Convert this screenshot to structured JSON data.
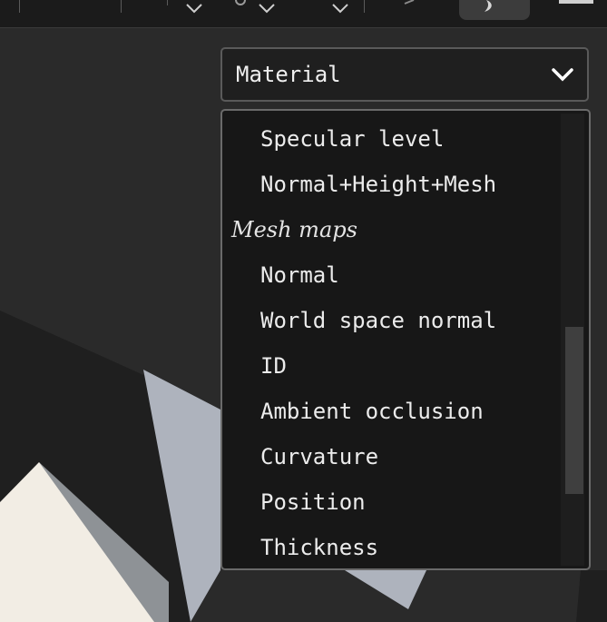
{
  "toolbar": {
    "icons": [
      "separator",
      "chevron-down-icon",
      "chevron-down-icon",
      "chevron-down-icon",
      "separator",
      "moon-icon",
      "panel-icon"
    ]
  },
  "channel_select": {
    "selected": "Material",
    "icon": "chevron-down-icon"
  },
  "dropdown": {
    "items": [
      {
        "label": "Specular level",
        "type": "option"
      },
      {
        "label": "Normal+Height+Mesh",
        "type": "option"
      },
      {
        "label": "Mesh maps",
        "type": "group"
      },
      {
        "label": "Normal",
        "type": "option"
      },
      {
        "label": "World space normal",
        "type": "option"
      },
      {
        "label": "ID",
        "type": "option"
      },
      {
        "label": "Ambient occlusion",
        "type": "option"
      },
      {
        "label": "Curvature",
        "type": "option"
      },
      {
        "label": "Position",
        "type": "option"
      },
      {
        "label": "Thickness",
        "type": "option"
      }
    ]
  },
  "colors": {
    "background": "#2a2a2a",
    "toolbar": "#1b1b1b",
    "dropdown_bg": "#171717",
    "mesh_light": "#f2ede4",
    "mesh_grey": "#aeb3bd"
  }
}
